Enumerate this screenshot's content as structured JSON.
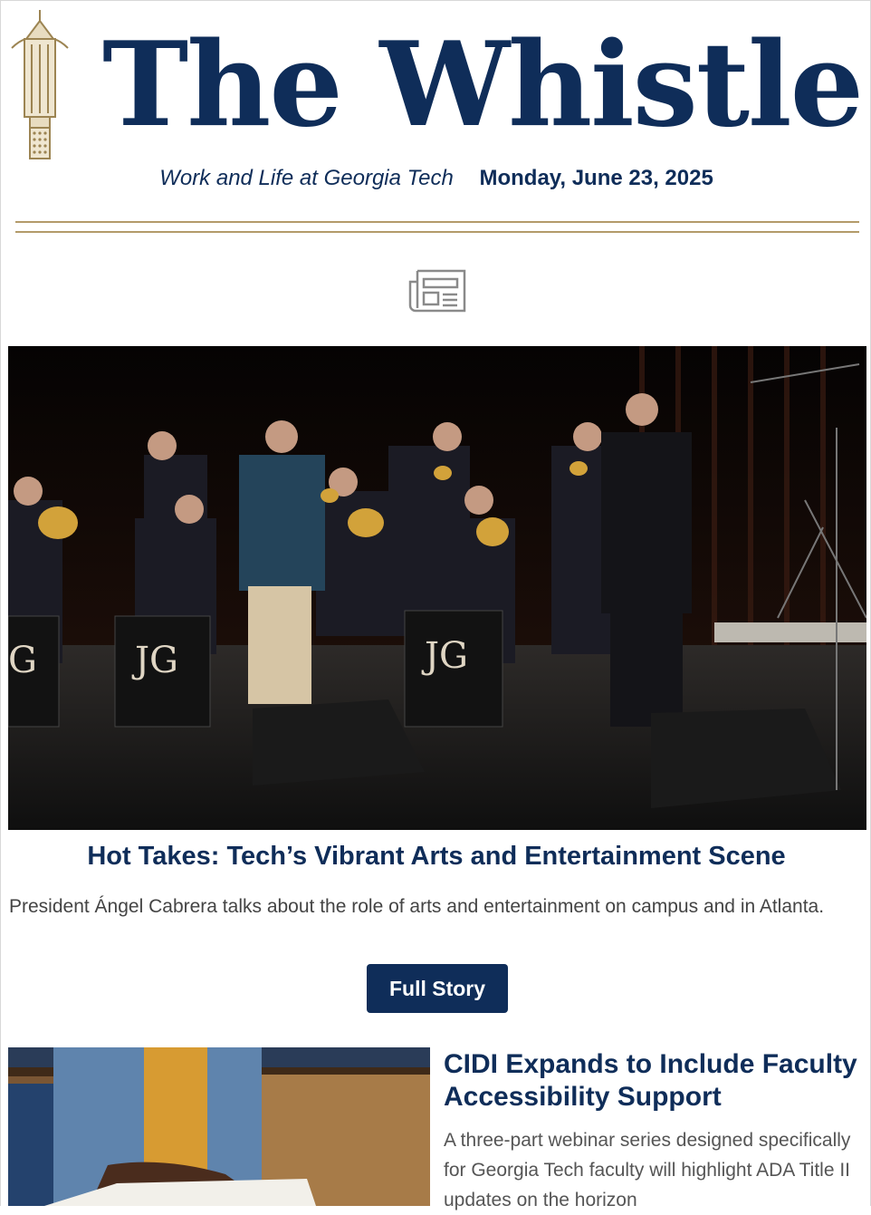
{
  "header": {
    "title": "The Whistle",
    "tagline": "Work and Life at Georgia Tech",
    "date": "Monday, June 23, 2025",
    "logo_icon": "steam-whistle-icon",
    "section_icon": "newspaper-icon"
  },
  "featured": {
    "image_alt": "Jazz musicians performing on stage with trumpets and trombones",
    "title": "Hot Takes: Tech’s Vibrant Arts and Entertainment Scene",
    "dek": "President Ángel Cabrera talks about the role of arts and entertainment on campus and in Atlanta.",
    "button_label": "Full Story"
  },
  "story2": {
    "image_alt": "Hands reading braille",
    "title": "CIDI Expands to Include Faculty Accessibility Support",
    "dek": "A three-part webinar series designed specifically for Georgia Tech faculty will highlight ADA Title II updates on the horizon"
  },
  "colors": {
    "navy": "#0f2d59",
    "gold": "#b39b6a"
  }
}
